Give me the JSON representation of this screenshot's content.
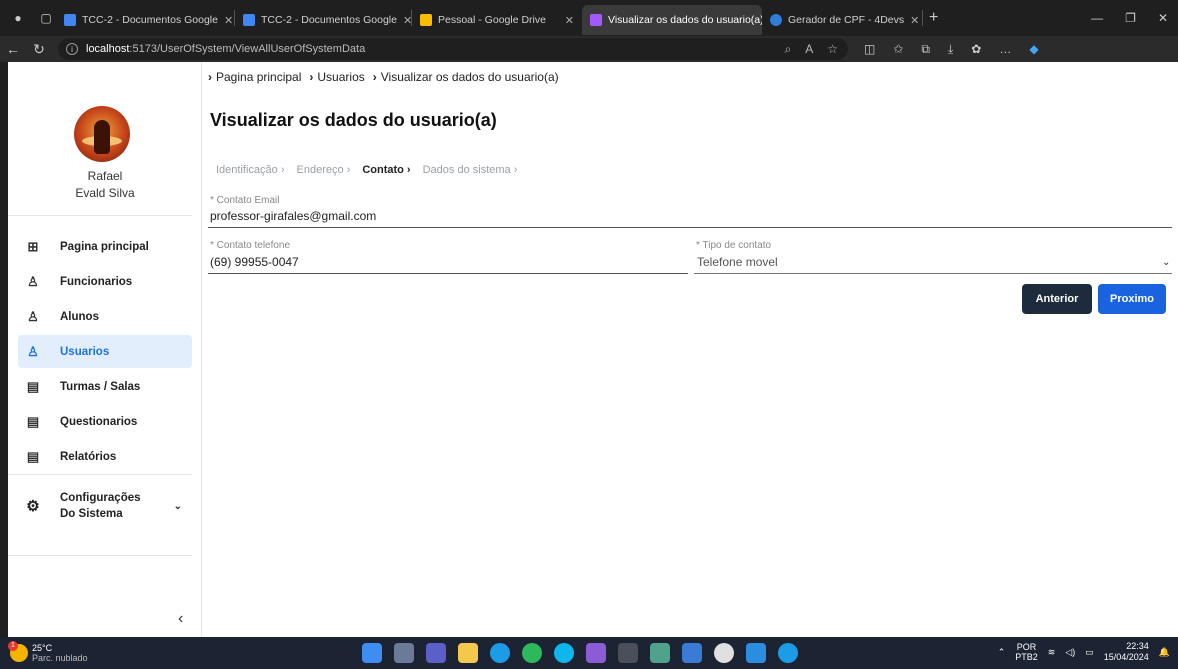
{
  "browser": {
    "tabs": [
      {
        "label": "TCC-2 - Documentos Google",
        "color": "#4285f4"
      },
      {
        "label": "TCC-2 - Documentos Google",
        "color": "#4285f4"
      },
      {
        "label": "Pessoal - Google Drive",
        "color": "#fbbc04"
      },
      {
        "label": "Visualizar os dados do usuario(a)",
        "color": "#a259ff",
        "active": true
      },
      {
        "label": "Gerador de CPF - 4Devs",
        "color": "#2e7dd7"
      }
    ],
    "url_host": "localhost",
    "url_path": ":5173/UserOfSystem/ViewAllUserOfSystemData"
  },
  "sidebar": {
    "user_first": "Rafael",
    "user_last": "Evald Silva",
    "items": [
      {
        "label": "Pagina principal",
        "icon": "grid-icon",
        "glyph": "⊞"
      },
      {
        "label": "Funcionarios",
        "icon": "user-icon",
        "glyph": "♙"
      },
      {
        "label": "Alunos",
        "icon": "user-icon",
        "glyph": "♙"
      },
      {
        "label": "Usuarios",
        "icon": "user-icon",
        "glyph": "♙",
        "active": true
      },
      {
        "label": "Turmas / Salas",
        "icon": "document-icon",
        "glyph": "▤"
      },
      {
        "label": "Questionarios",
        "icon": "document-icon",
        "glyph": "▤"
      },
      {
        "label": "Relatórios",
        "icon": "document-icon",
        "glyph": "▤"
      }
    ],
    "config_label": "Configurações Do Sistema"
  },
  "main": {
    "breadcrumb": [
      "Pagina principal",
      "Usuarios",
      "Visualizar os dados do usuario(a)"
    ],
    "title": "Visualizar os dados do usuario(a)",
    "steps": [
      "Identificação",
      "Endereço",
      "Contato",
      "Dados do sistema"
    ],
    "current_step": "Contato",
    "email_label": "* Contato Email",
    "email_value": "professor-girafales@gmail.com",
    "phone_label": "* Contato telefone",
    "phone_value": "(69) 99955-0047",
    "type_label": "* Tipo de contato",
    "type_value": "Telefone movel",
    "btn_prev": "Anterior",
    "btn_next": "Proximo"
  },
  "taskbar": {
    "temp": "25°C",
    "weather": "Parc. nublado",
    "badge": "1",
    "lang1": "POR",
    "lang2": "PTB2",
    "time": "22:34",
    "date": "15/04/2024"
  }
}
